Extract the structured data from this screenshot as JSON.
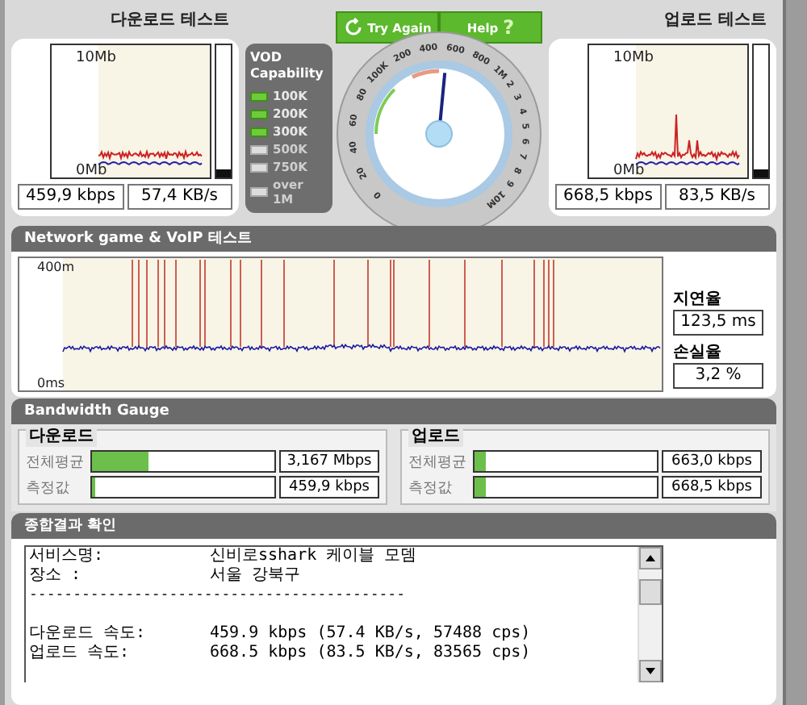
{
  "download_test": {
    "title": "다운로드 테스트",
    "axis_top": "10Mb",
    "axis_bottom": "0Mb",
    "meter": {
      "level": 0.06
    },
    "readouts": [
      "459,9 kbps",
      "57,4 KB/s"
    ]
  },
  "buttons": [
    {
      "label": "Try Again",
      "kind": "refresh"
    },
    {
      "label": "Help",
      "kind": "help",
      "icon": "?"
    }
  ],
  "vod": {
    "title": "VOD Capability",
    "levels": [
      {
        "label": "100K",
        "on": true
      },
      {
        "label": "200K",
        "on": true
      },
      {
        "label": "300K",
        "on": true
      },
      {
        "label": "500K",
        "on": false
      },
      {
        "label": "750K",
        "on": false
      },
      {
        "label": "over 1M",
        "on": false
      }
    ]
  },
  "speed_dial": {
    "labels": [
      "0",
      "20",
      "40",
      "60",
      "80",
      "100K",
      "200",
      "400",
      "600",
      "800",
      "1M",
      "2",
      "3",
      "4",
      "5",
      "6",
      "7",
      "8",
      "9",
      "10M"
    ],
    "level": 0.52
  },
  "upload_test": {
    "title": "업로드 테스트",
    "axis_top": "10Mb",
    "axis_bottom": "0Mb",
    "meter": {
      "level": 0.06
    },
    "readouts": [
      "668,5 kbps",
      "83,5 KB/s"
    ]
  },
  "latency_section": {
    "title": "Network game & VoIP 테스트",
    "axis_top": "400m",
    "axis_bottom": "0ms",
    "stats": [
      {
        "label": "지연율",
        "value": "123,5 ms"
      },
      {
        "label": "손실율",
        "value": "3,2 %"
      }
    ]
  },
  "bandwidth_section": {
    "title": "Bandwidth Gauge",
    "groups": [
      {
        "title": "다운로드",
        "rows": [
          {
            "label": "전체평균",
            "level": 0.31,
            "value": "3,167 Mbps"
          },
          {
            "label": "측정값",
            "level": 0.02,
            "value": "459,9 kbps"
          }
        ]
      },
      {
        "title": "업로드",
        "rows": [
          {
            "label": "전체평균",
            "level": 0.06,
            "value": "663,0 kbps"
          },
          {
            "label": "측정값",
            "level": 0.06,
            "value": "668,5 kbps"
          }
        ]
      }
    ]
  },
  "summary_section": {
    "title": "종합결과 확인",
    "lines": [
      {
        "kind": "field",
        "label": "서비스명:",
        "value": "신비로sshark 케이블 모뎀"
      },
      {
        "kind": "field",
        "label": "장소 :",
        "value": "서울 강북구"
      },
      {
        "kind": "rule",
        "text": "-------------------------------------------"
      },
      {
        "kind": "blank"
      },
      {
        "kind": "field",
        "label": "다운로드 속도:",
        "value": "459.9 kbps (57.4 KB/s, 57488 cps)"
      },
      {
        "kind": "field",
        "label": "업로드 속도:",
        "value": "668.5 kbps (83.5 KB/s, 83565 cps)"
      }
    ]
  }
}
